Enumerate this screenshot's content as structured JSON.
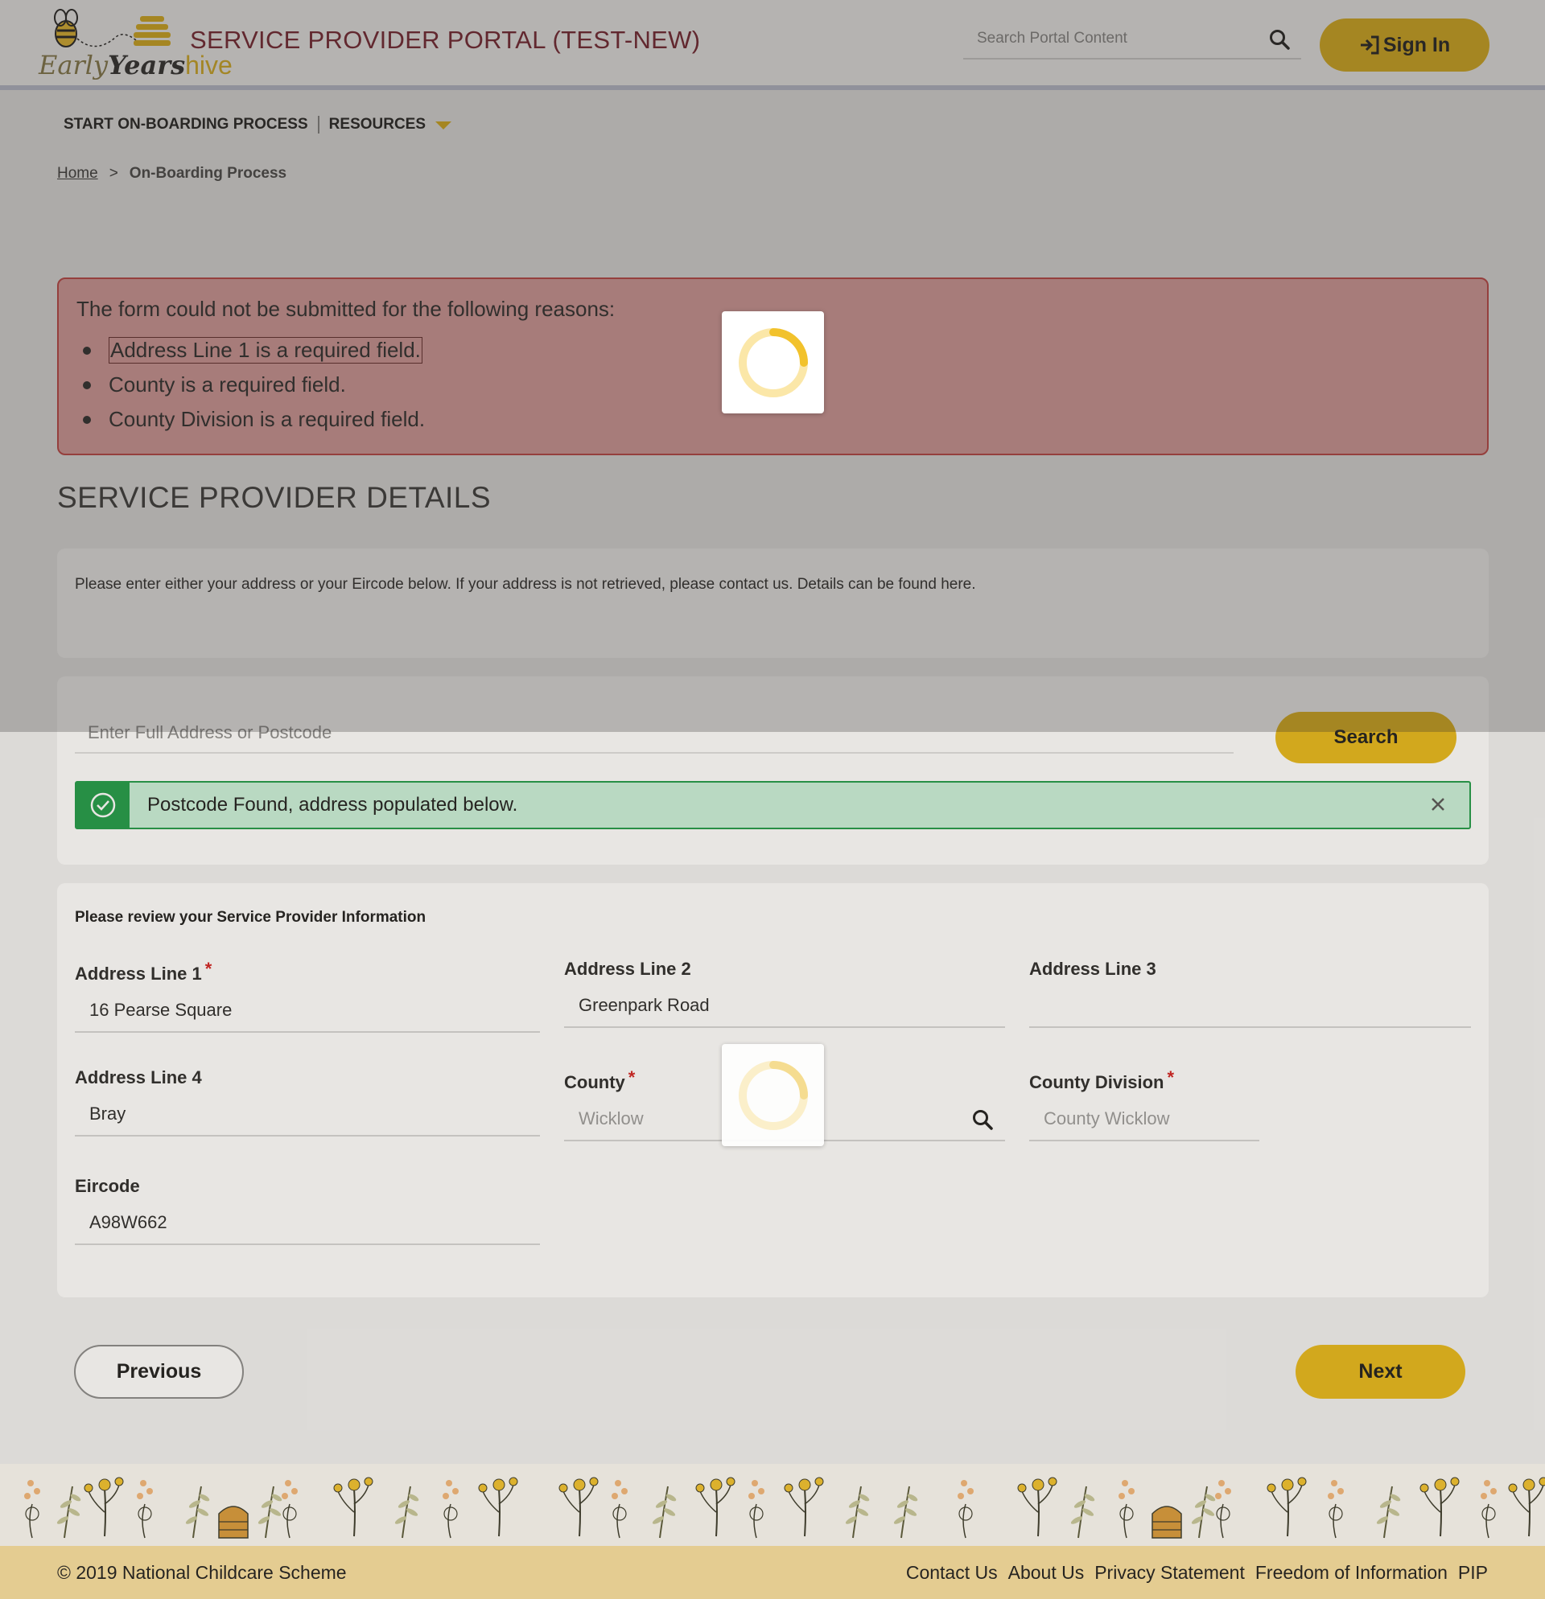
{
  "header": {
    "logo": {
      "early": "Early",
      "years": "Years",
      "hive": "hive"
    },
    "title": "SERVICE PROVIDER PORTAL (TEST-NEW)",
    "search_placeholder": "Search Portal Content",
    "signin_label": "Sign In"
  },
  "nav": {
    "items": [
      {
        "label": "START ON-BOARDING PROCESS"
      },
      {
        "label": "RESOURCES"
      }
    ]
  },
  "breadcrumb": {
    "home": "Home",
    "separator": ">",
    "current": "On-Boarding Process"
  },
  "error": {
    "heading": "The form could not be submitted for the following reasons:",
    "items": [
      "Address Line 1 is a required field.",
      "County is a required field.",
      "County Division is a required field."
    ]
  },
  "section_title": "SERVICE PROVIDER DETAILS",
  "intro_text": "Please enter either your address or your Eircode below. If your address is not retrieved, please contact us. Details can be found here.",
  "lookup": {
    "placeholder": "Enter Full Address or Postcode",
    "search_label": "Search",
    "success_message": "Postcode Found, address populated below."
  },
  "review": {
    "title": "Please review your Service Provider Information",
    "fields": {
      "address1": {
        "label": "Address Line 1",
        "value": "16 Pearse Square",
        "required": "*"
      },
      "address2": {
        "label": "Address Line 2",
        "value": "Greenpark Road"
      },
      "address3": {
        "label": "Address Line 3",
        "value": ""
      },
      "address4": {
        "label": "Address Line 4",
        "value": "Bray"
      },
      "county": {
        "label": "County",
        "placeholder": "Wicklow",
        "required": "*"
      },
      "county_division": {
        "label": "County Division",
        "placeholder": "County Wicklow",
        "required": "*"
      },
      "eircode": {
        "label": "Eircode",
        "value": "A98W662"
      }
    }
  },
  "buttons": {
    "previous": "Previous",
    "next": "Next"
  },
  "footer": {
    "copyright": "© 2019 National Childcare Scheme",
    "links": [
      "Contact Us",
      "About Us",
      "Privacy Statement",
      "Freedom of Information",
      "PIP"
    ]
  },
  "colors": {
    "accent": "#e6b719",
    "title": "#7a1f2e",
    "error_bg": "#e8a6a6",
    "success_bg": "#c9f0d9",
    "success": "#1f9a47",
    "required": "#d12020"
  }
}
